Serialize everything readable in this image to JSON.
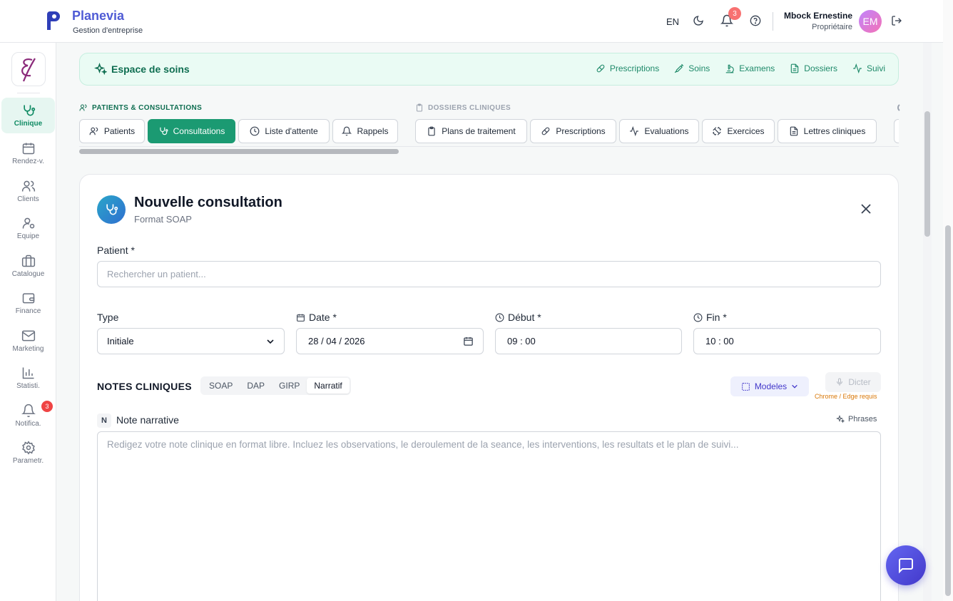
{
  "header": {
    "brand_name": "Planevia",
    "brand_subtitle": "Gestion d'entreprise",
    "language": "EN",
    "notification_count": "3",
    "user_name": "Mbock Ernestine",
    "user_role": "Propriétaire",
    "avatar_initials": "EM"
  },
  "sidebar": {
    "items": [
      {
        "label": "Clinique",
        "icon": "stethoscope-icon"
      },
      {
        "label": "Rendez-v.",
        "icon": "calendar-icon"
      },
      {
        "label": "Clients",
        "icon": "users-icon"
      },
      {
        "label": "Equipe",
        "icon": "team-icon"
      },
      {
        "label": "Catalogue",
        "icon": "briefcase-icon"
      },
      {
        "label": "Finance",
        "icon": "wallet-icon"
      },
      {
        "label": "Marketing",
        "icon": "mail-icon"
      },
      {
        "label": "Statisti.",
        "icon": "chart-icon"
      },
      {
        "label": "Notifica.",
        "icon": "bell-icon"
      },
      {
        "label": "Parametr.",
        "icon": "gear-icon"
      }
    ],
    "notifications_badge": "3"
  },
  "space_bar": {
    "title": "Espace de soins",
    "links": [
      "Prescriptions",
      "Soins",
      "Examens",
      "Dossiers",
      "Suivi"
    ]
  },
  "sections": {
    "patients_label": "PATIENTS & CONSULTATIONS",
    "dossiers_label": "DOSSIERS CLINIQUES",
    "tabs_patients": [
      "Patients",
      "Consultations",
      "Liste d'attente",
      "Rappels"
    ],
    "tabs_dossiers": [
      "Plans de traitement",
      "Prescriptions",
      "Evaluations",
      "Exercices",
      "Lettres cliniques"
    ]
  },
  "form": {
    "title": "Nouvelle consultation",
    "subtitle": "Format SOAP",
    "patient_label": "Patient *",
    "patient_placeholder": "Rechercher un patient...",
    "type_label": "Type",
    "type_value": "Initiale",
    "date_label": "Date *",
    "date_value": "28 / 04 / 2026",
    "start_label": "Début *",
    "start_value": "09 : 00",
    "end_label": "Fin *",
    "end_value": "10 : 00",
    "notes_title": "NOTES CLINIQUES",
    "formats": [
      "SOAP",
      "DAP",
      "GIRP",
      "Narratif"
    ],
    "active_format": "Narratif",
    "modeles_label": "Modeles",
    "dicter_label": "Dicter",
    "dicter_note": "Chrome / Edge requis",
    "note_badge": "N",
    "note_label": "Note narrative",
    "phrases_label": "Phrases",
    "note_placeholder": "Redigez votre note clinique en format libre. Incluez les observations, le deroulement de la seance, les interventions, les resultats et le plan de suivi..."
  },
  "colors": {
    "brand": "#4f5bd5",
    "accent_green": "#1b9a72",
    "badge_red": "#ef4444"
  }
}
